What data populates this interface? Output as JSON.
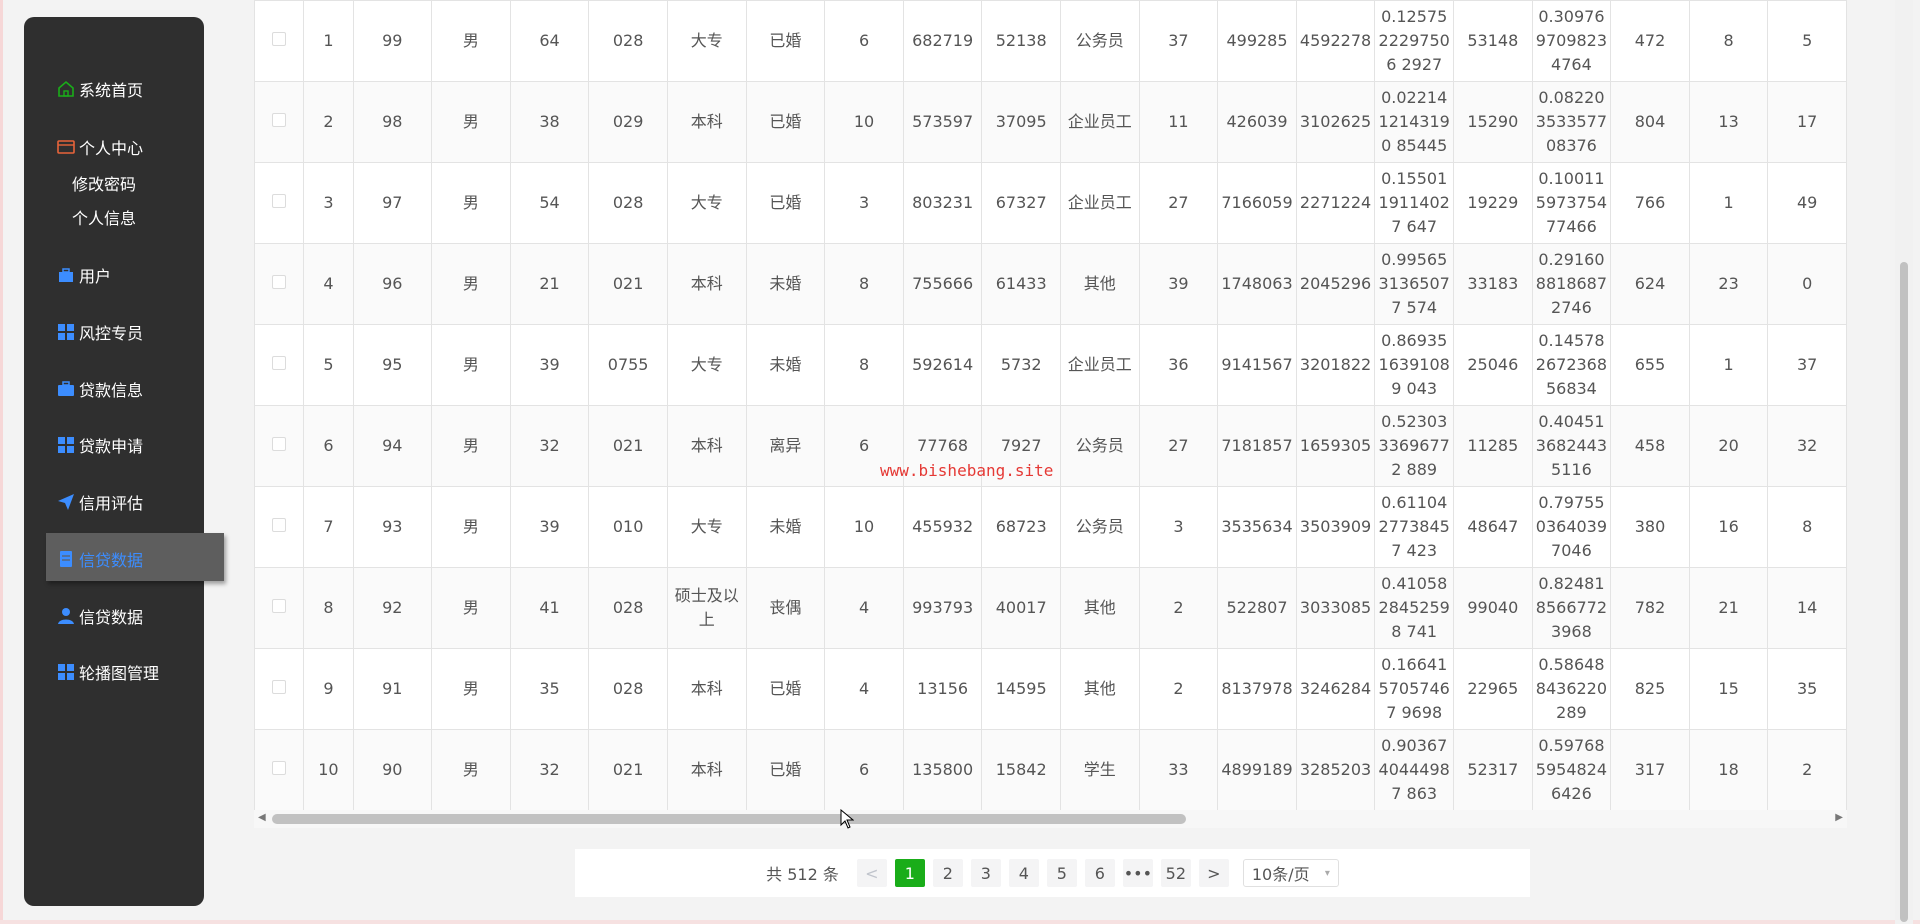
{
  "sidebar": {
    "items": [
      {
        "label": "系统首页",
        "icon": "home-icon"
      },
      {
        "label": "个人中心",
        "icon": "profile-card-icon"
      },
      {
        "label": "用户",
        "icon": "briefcase-icon"
      },
      {
        "label": "风控专员",
        "icon": "grid-icon"
      },
      {
        "label": "贷款信息",
        "icon": "briefcase-icon"
      },
      {
        "label": "贷款申请",
        "icon": "grid-icon"
      },
      {
        "label": "信用评估",
        "icon": "paper-plane-icon"
      },
      {
        "label": "信贷数据",
        "icon": "document-icon",
        "active": true
      },
      {
        "label": "信贷数据",
        "icon": "user-icon"
      },
      {
        "label": "轮播图管理",
        "icon": "grid-icon"
      }
    ],
    "subitems": [
      "修改密码",
      "个人信息"
    ],
    "accent_color": "#1aad19",
    "active_color": "#3c8dff"
  },
  "table": {
    "rows": [
      [
        "1",
        "99",
        "男",
        "64",
        "028",
        "大专",
        "已婚",
        "6",
        "682719",
        "52138",
        "公务员",
        "37",
        "499285",
        "4592278",
        "0.1257522297506 2927",
        "53148",
        "0.309769709823 4764",
        "472",
        "8",
        "5"
      ],
      [
        "2",
        "98",
        "男",
        "38",
        "029",
        "本科",
        "已婚",
        "10",
        "573597",
        "37095",
        "企业员工",
        "11",
        "426039",
        "3102625",
        "0.0221412143190 85445",
        "15290",
        "0.082203533577 08376",
        "804",
        "13",
        "17"
      ],
      [
        "3",
        "97",
        "男",
        "54",
        "028",
        "大专",
        "已婚",
        "3",
        "803231",
        "67327",
        "企业员工",
        "27",
        "7166059",
        "2271224",
        "0.1550119114027 647",
        "19229",
        "0.100115973754 77466",
        "766",
        "1",
        "49"
      ],
      [
        "4",
        "96",
        "男",
        "21",
        "021",
        "本科",
        "未婚",
        "8",
        "755666",
        "61433",
        "其他",
        "39",
        "1748063",
        "2045296",
        "0.9956531365077 574",
        "33183",
        "0.291608818687 2746",
        "624",
        "23",
        "0"
      ],
      [
        "5",
        "95",
        "男",
        "39",
        "0755",
        "大专",
        "未婚",
        "8",
        "592614",
        "5732",
        "企业员工",
        "36",
        "9141567",
        "3201822",
        "0.8693516391089 043",
        "25046",
        "0.145782672368 56834",
        "655",
        "1",
        "37"
      ],
      [
        "6",
        "94",
        "男",
        "32",
        "021",
        "本科",
        "离异",
        "6",
        "77768",
        "7927",
        "公务员",
        "27",
        "7181857",
        "1659305",
        "0.5230333696772 889",
        "11285",
        "0.404513682443 5116",
        "458",
        "20",
        "32"
      ],
      [
        "7",
        "93",
        "男",
        "39",
        "010",
        "大专",
        "未婚",
        "10",
        "455932",
        "68723",
        "公务员",
        "3",
        "3535634",
        "3503909",
        "0.6110427738457 423",
        "48647",
        "0.797550364039 7046",
        "380",
        "16",
        "8"
      ],
      [
        "8",
        "92",
        "男",
        "41",
        "028",
        "硕士及以上",
        "丧偶",
        "4",
        "993793",
        "40017",
        "其他",
        "2",
        "522807",
        "3033085",
        "0.4105828452598 741",
        "99040",
        "0.824818566772 3968",
        "782",
        "21",
        "14"
      ],
      [
        "9",
        "91",
        "男",
        "35",
        "028",
        "本科",
        "已婚",
        "4",
        "13156",
        "14595",
        "其他",
        "2",
        "8137978",
        "3246284",
        "0.1664157057467 9698",
        "22965",
        "0.586488436220 289",
        "825",
        "15",
        "35"
      ],
      [
        "10",
        "90",
        "男",
        "32",
        "021",
        "本科",
        "已婚",
        "6",
        "135800",
        "15842",
        "学生",
        "33",
        "4899189",
        "3285203",
        "0.9036740444987 863",
        "52317",
        "0.597685954824 6426",
        "317",
        "18",
        "2"
      ]
    ]
  },
  "pager": {
    "total": "共 512 条",
    "prev": "<",
    "pages": [
      "1",
      "2",
      "3",
      "4",
      "5",
      "6"
    ],
    "ellipsis": "•••",
    "last": "52",
    "next": ">",
    "size": "10条/页"
  },
  "watermark": "www.bishebang.site"
}
